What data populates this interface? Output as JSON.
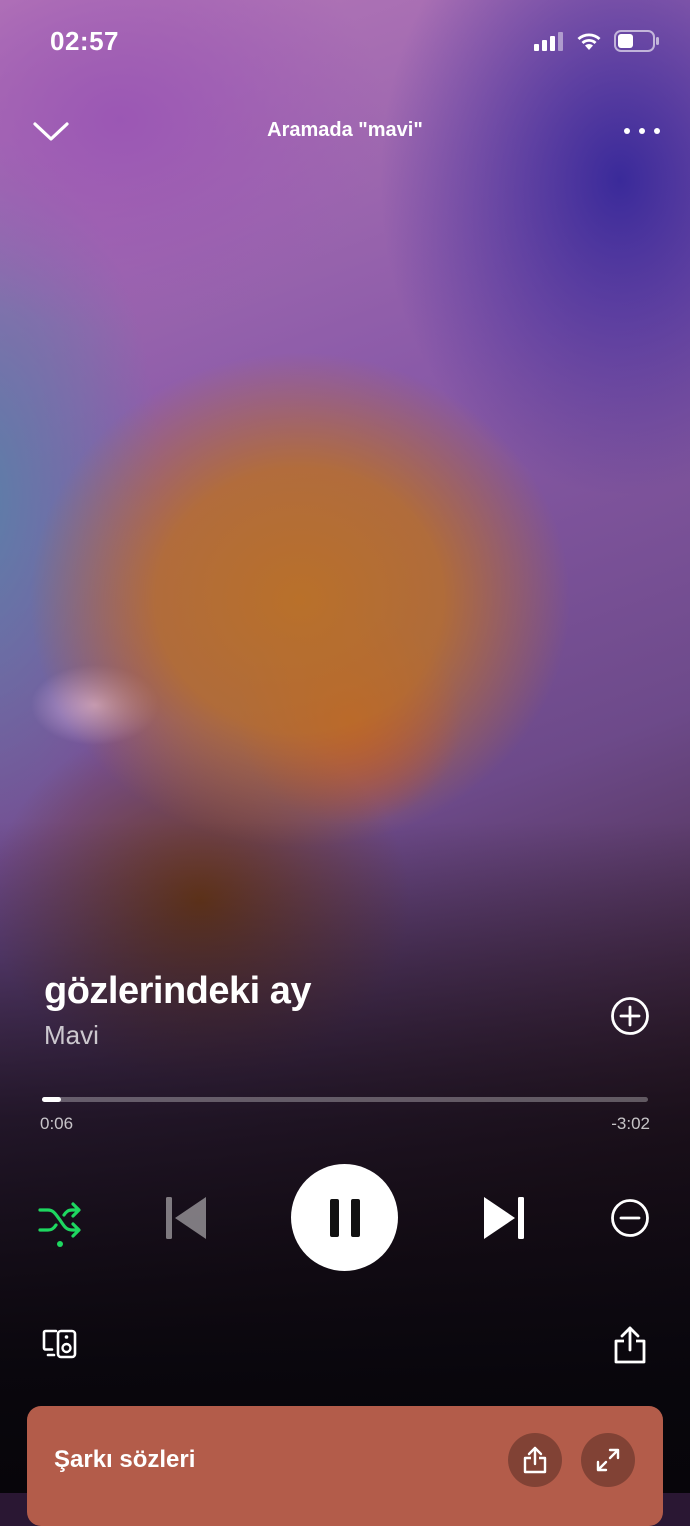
{
  "status_bar": {
    "time": "02:57",
    "icons": [
      "cellular-signal-icon",
      "wifi-icon",
      "battery-icon"
    ]
  },
  "header": {
    "context": "Aramada \"mavi\"",
    "icons": [
      "chevron-down-icon",
      "more-options-icon"
    ]
  },
  "track": {
    "title": "gözlerindeki ay",
    "artist": "Mavi"
  },
  "progress": {
    "elapsed": "0:06",
    "remaining": "-3:02",
    "fraction": 0.032
  },
  "controls": {
    "shuffle_active": true,
    "accent_color": "#1ed760",
    "icons": [
      "shuffle-icon",
      "previous-icon",
      "pause-icon",
      "next-icon",
      "hide-song-icon"
    ]
  },
  "bottom": {
    "icons": [
      "connect-devices-icon",
      "share-icon"
    ]
  },
  "lyrics_card": {
    "label": "Şarkı sözleri",
    "background": "#b35c4a",
    "icons": [
      "share-icon",
      "expand-icon"
    ]
  }
}
